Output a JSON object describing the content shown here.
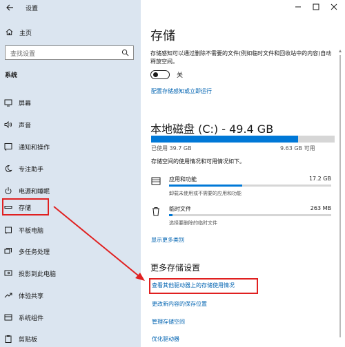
{
  "app": {
    "title": "设置"
  },
  "sidebar": {
    "home_label": "主页",
    "search_placeholder": "查找设置",
    "section_label": "系统",
    "items": [
      {
        "label": "屏幕",
        "icon": "monitor-icon"
      },
      {
        "label": "声音",
        "icon": "speaker-icon"
      },
      {
        "label": "通知和操作",
        "icon": "notification-icon"
      },
      {
        "label": "专注助手",
        "icon": "moon-icon"
      },
      {
        "label": "电源和睡眠",
        "icon": "power-icon"
      },
      {
        "label": "存储",
        "icon": "storage-icon"
      },
      {
        "label": "平板电脑",
        "icon": "tablet-icon"
      },
      {
        "label": "多任务处理",
        "icon": "multitask-icon"
      },
      {
        "label": "投影到此电脑",
        "icon": "project-icon"
      },
      {
        "label": "体验共享",
        "icon": "share-icon"
      },
      {
        "label": "系统组件",
        "icon": "components-icon"
      },
      {
        "label": "剪贴板",
        "icon": "clipboard-icon"
      }
    ]
  },
  "main": {
    "title": "存储",
    "sense_desc": "存储感知可以通过删除不需要的文件(例如临时文件和回收站中的内容)自动释放空间。",
    "toggle_label": "关",
    "toggle_on": false,
    "configure_link": "配置存储感知或立即运行",
    "drive_title": "本地磁盘 (C:) - 49.4 GB",
    "used_label": "已使用 39.7 GB",
    "free_label": "9.63 GB 可用",
    "used_fraction": 0.8,
    "usage_desc": "存储空间的使用情况和可用情况如下。",
    "categories": [
      {
        "name": "应用和功能",
        "size": "17.2 GB",
        "desc": "卸载未使用或不需要的应用和功能",
        "fraction": 0.45
      },
      {
        "name": "临时文件",
        "size": "263 MB",
        "desc": "选择要删除的临时文件",
        "fraction": 0.02
      }
    ],
    "show_more_link": "显示更多类别",
    "more_settings_title": "更多存储设置",
    "links": [
      "查看其他驱动器上的存储使用情况",
      "更改新内容的保存位置",
      "管理存储空间",
      "优化驱动器"
    ]
  },
  "colors": {
    "accent": "#0078d7",
    "link": "#0063b1",
    "highlight": "#e02020",
    "sidebar_bg": "#dbe5f0"
  }
}
